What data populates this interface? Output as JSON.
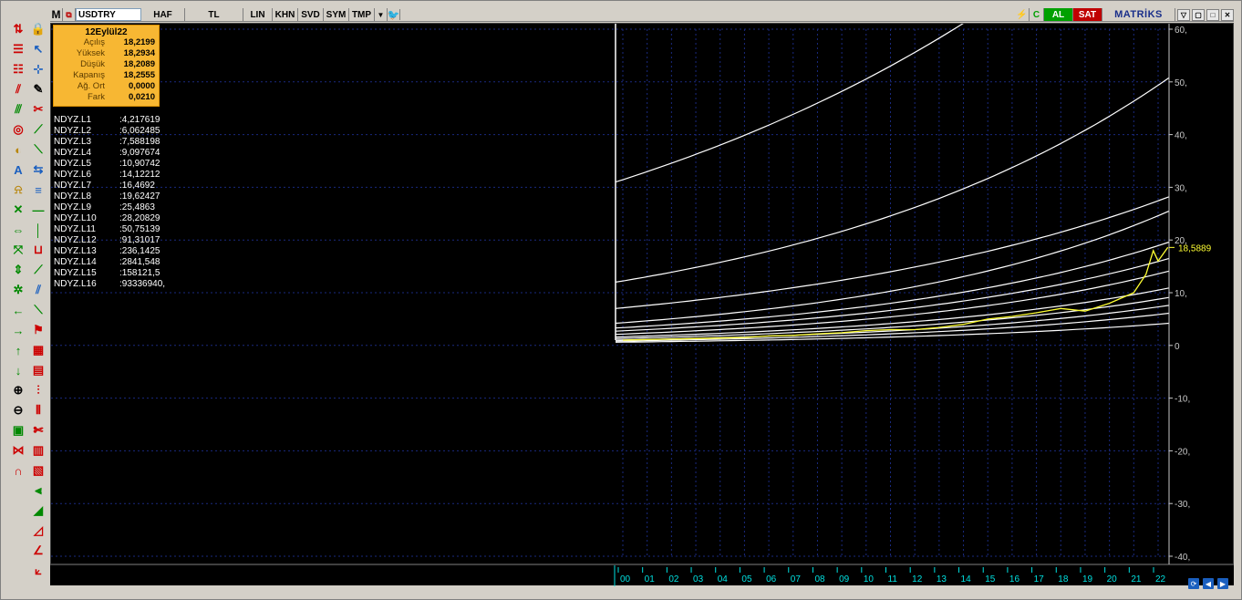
{
  "topbar": {
    "logo": "M",
    "symbol": "USDTRY",
    "buttons": [
      "HAF",
      "TL",
      "LIN",
      "KHN",
      "SVD",
      "SYM",
      "TMP"
    ],
    "buy_label": "AL",
    "sell_label": "SAT",
    "brand": "MATRİKS"
  },
  "info": {
    "date": "12Eylül22",
    "rows": [
      {
        "label": "Açılış",
        "value": "18,2199"
      },
      {
        "label": "Yüksek",
        "value": "18,2934"
      },
      {
        "label": "Düşük",
        "value": "18,2089"
      },
      {
        "label": "Kapanış",
        "value": "18,2555"
      },
      {
        "label": "Ağ. Ort",
        "value": "0,0000"
      },
      {
        "label": "Fark",
        "value": "0,0210"
      }
    ]
  },
  "levels": [
    {
      "name": "NDYZ.L1",
      "value": ":4,217619"
    },
    {
      "name": "NDYZ.L2",
      "value": ":6,062485"
    },
    {
      "name": "NDYZ.L3",
      "value": ":7,588198"
    },
    {
      "name": "NDYZ.L4",
      "value": ":9,097674"
    },
    {
      "name": "NDYZ.L5",
      "value": ":10,90742"
    },
    {
      "name": "NDYZ.L6",
      "value": ":14,12212"
    },
    {
      "name": "NDYZ.L7",
      "value": ":16,4692"
    },
    {
      "name": "NDYZ.L8",
      "value": ":19,62427"
    },
    {
      "name": "NDYZ.L9",
      "value": ":25,4863"
    },
    {
      "name": "NDYZ.L10",
      "value": ":28,20829"
    },
    {
      "name": "NDYZ.L11",
      "value": ":50,75139"
    },
    {
      "name": "NDYZ.L12",
      "value": ":91,31017"
    },
    {
      "name": "NDYZ.L13",
      "value": ":236,1425"
    },
    {
      "name": "NDYZ.L14",
      "value": ":2841,548"
    },
    {
      "name": "NDYZ.L15",
      "value": ":158121,5"
    },
    {
      "name": "NDYZ.L16",
      "value": ":93336940,"
    }
  ],
  "colors": {
    "background": "#000000",
    "price": "#ffff33",
    "curves": "#ffffff",
    "axis": "#c8c8c8",
    "grid": "#1a2a80",
    "xaxis_labels": "#00e0e0",
    "price_tag": "#ffff33"
  },
  "chart_data": {
    "type": "line",
    "yticks": [
      "60,",
      "50,",
      "40,",
      "30,",
      "20,",
      "10,",
      "0",
      "-10,",
      "-20,",
      "-30,",
      "-40,"
    ],
    "ylim": [
      -40,
      60
    ],
    "xticks": [
      "00",
      "01",
      "02",
      "03",
      "04",
      "05",
      "06",
      "07",
      "08",
      "09",
      "10",
      "11",
      "12",
      "13",
      "14",
      "15",
      "16",
      "17",
      "18",
      "19",
      "20",
      "21",
      "22"
    ],
    "last_price_label": "18,5889",
    "last_price": 18.5889,
    "series": [
      {
        "x": [
          "00",
          "01",
          "02",
          "03",
          "04",
          "05",
          "06",
          "07",
          "08",
          "09",
          "10",
          "11",
          "12",
          "13",
          "14",
          "15",
          "16",
          "17",
          "18",
          "19",
          "20",
          "21",
          "21.5",
          "21.8",
          "22",
          "22.4"
        ],
        "values": [
          1.0,
          1.1,
          1.2,
          1.3,
          1.4,
          1.5,
          1.8,
          1.9,
          2.2,
          2.4,
          2.8,
          3.0,
          3.0,
          3.4,
          4.0,
          5.0,
          5.5,
          6.2,
          7.0,
          6.5,
          8.0,
          10.0,
          13.5,
          18.0,
          16.0,
          18.6
        ]
      }
    ],
    "curves": [
      {
        "label": "NDYZ.L1",
        "start": 0.6,
        "end": 4.2
      },
      {
        "label": "NDYZ.L2",
        "start": 0.8,
        "end": 6.1
      },
      {
        "label": "NDYZ.L3",
        "start": 1.0,
        "end": 7.6
      },
      {
        "label": "NDYZ.L4",
        "start": 1.3,
        "end": 9.1
      },
      {
        "label": "NDYZ.L5",
        "start": 1.6,
        "end": 10.9
      },
      {
        "label": "NDYZ.L6",
        "start": 2.1,
        "end": 14.1
      },
      {
        "label": "NDYZ.L7",
        "start": 2.7,
        "end": 16.5
      },
      {
        "label": "NDYZ.L8",
        "start": 3.3,
        "end": 19.6
      },
      {
        "label": "NDYZ.L9",
        "start": 4.2,
        "end": 25.5
      },
      {
        "label": "NDYZ.L10",
        "start": 7.0,
        "end": 28.2
      },
      {
        "label": "NDYZ.L11",
        "start": 12.0,
        "end": 50.8
      },
      {
        "label": "NDYZ.L12",
        "start": 31.0,
        "end": 91.3
      }
    ]
  }
}
